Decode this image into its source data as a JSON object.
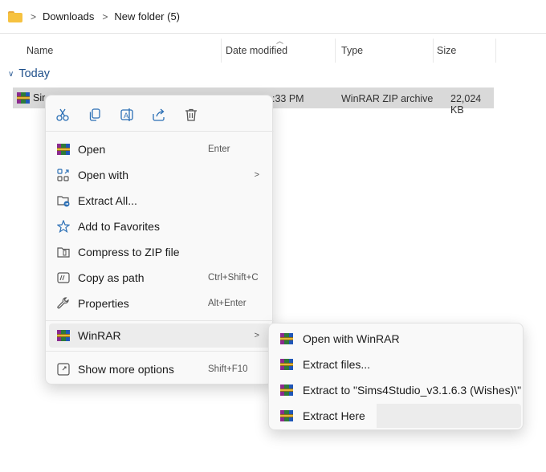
{
  "breadcrumb": {
    "items": [
      "Downloads",
      "New folder (5)"
    ],
    "separator": ">"
  },
  "columns": {
    "name": "Name",
    "date": "Date modified",
    "type": "Type",
    "size": "Size"
  },
  "group": {
    "label": "Today"
  },
  "file": {
    "name": "Sir",
    "date": ":33 PM",
    "type": "WinRAR ZIP archive",
    "size": "22,024 KB"
  },
  "context_menu": {
    "quick_actions": [
      "cut-icon",
      "copy-icon",
      "rename-icon",
      "share-icon",
      "delete-icon"
    ],
    "items": [
      {
        "label": "Open",
        "accel": "Enter",
        "icon": "winrar-icon"
      },
      {
        "label": "Open with",
        "accel": "",
        "icon": "open-with-icon",
        "submenu": true
      },
      {
        "label": "Extract All...",
        "accel": "",
        "icon": "extract-all-icon"
      },
      {
        "label": "Add to Favorites",
        "accel": "",
        "icon": "star-icon"
      },
      {
        "label": "Compress to ZIP file",
        "accel": "",
        "icon": "zip-icon"
      },
      {
        "label": "Copy as path",
        "accel": "Ctrl+Shift+C",
        "icon": "copy-path-icon"
      },
      {
        "label": "Properties",
        "accel": "Alt+Enter",
        "icon": "wrench-icon"
      },
      {
        "label": "WinRAR",
        "accel": "",
        "icon": "winrar-icon",
        "submenu": true
      },
      {
        "label": "Show more options",
        "accel": "Shift+F10",
        "icon": "more-options-icon"
      }
    ]
  },
  "winrar_submenu": {
    "items": [
      {
        "label": "Open with WinRAR"
      },
      {
        "label": "Extract files..."
      },
      {
        "label": "Extract to \"Sims4Studio_v3.1.6.3 (Wishes)\\\""
      },
      {
        "label": "Extract Here"
      }
    ]
  },
  "colors": {
    "highlight": "#f5f53a",
    "group_text": "#1e4f8a",
    "selection": "#d9d9d9"
  }
}
